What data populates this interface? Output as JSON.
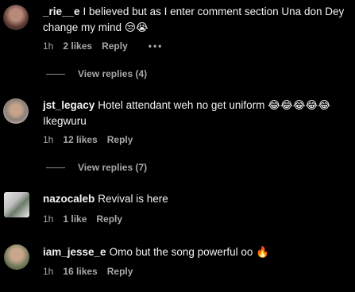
{
  "comments": [
    {
      "username": "_rie__e",
      "text": "I believed but as I enter comment section Una don Dey change my mind",
      "emojis": [
        "😒",
        "😭"
      ],
      "time": "1h",
      "likes": "2 likes",
      "reply": "Reply",
      "more": "•••",
      "view_replies": "View replies (4)"
    },
    {
      "username": "jst_legacy",
      "text": "Hotel attendant weh no get uniform",
      "emojis": [
        "😂",
        "😂",
        "😂",
        "😂",
        "😂"
      ],
      "text2": "Ikegwuru",
      "time": "1h",
      "likes": "12 likes",
      "reply": "Reply",
      "view_replies": "View replies (7)"
    },
    {
      "username": "nazocaleb",
      "text": "Revival is here",
      "time": "1h",
      "likes": "1 like",
      "reply": "Reply"
    },
    {
      "username": "iam_jesse_e",
      "text": "Omo but the song powerful oo",
      "emojis": [
        "🔥"
      ],
      "time": "1h",
      "likes": "16 likes",
      "reply": "Reply"
    }
  ],
  "colors": {
    "background": "#000000",
    "text": "#f2f2f2",
    "meta": "#a8a8a8",
    "emoji_face": "#f6c43a",
    "fire": "#ff6a1a"
  }
}
